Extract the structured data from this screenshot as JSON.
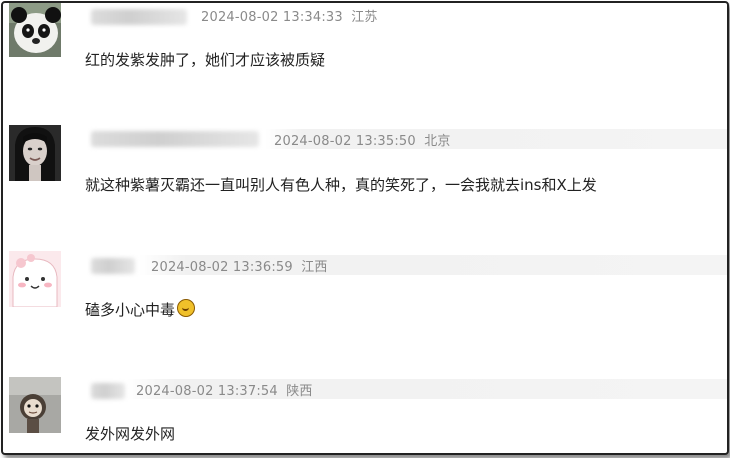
{
  "comments": [
    {
      "timestamp": "2024-08-02 13:34:33",
      "location": "江苏",
      "text": "红的发紫发肿了，她们才应该被质疑",
      "avatar": "panda-avatar"
    },
    {
      "timestamp": "2024-08-02 13:35:50",
      "location": "北京",
      "text": "就这种紫薯灭霸还一直叫别人有色人种，真的笑死了，一会我就去ins和X上发",
      "avatar": "woman-avatar"
    },
    {
      "timestamp": "2024-08-02 13:36:59",
      "location": "江西",
      "text": "磕多小心中毒",
      "avatar": "pink-cartoon-avatar",
      "emoji": "laugh-emoji"
    },
    {
      "timestamp": "2024-08-02 13:37:54",
      "location": "陕西",
      "text": "发外网发外网",
      "avatar": "cartoon-face-avatar"
    }
  ]
}
